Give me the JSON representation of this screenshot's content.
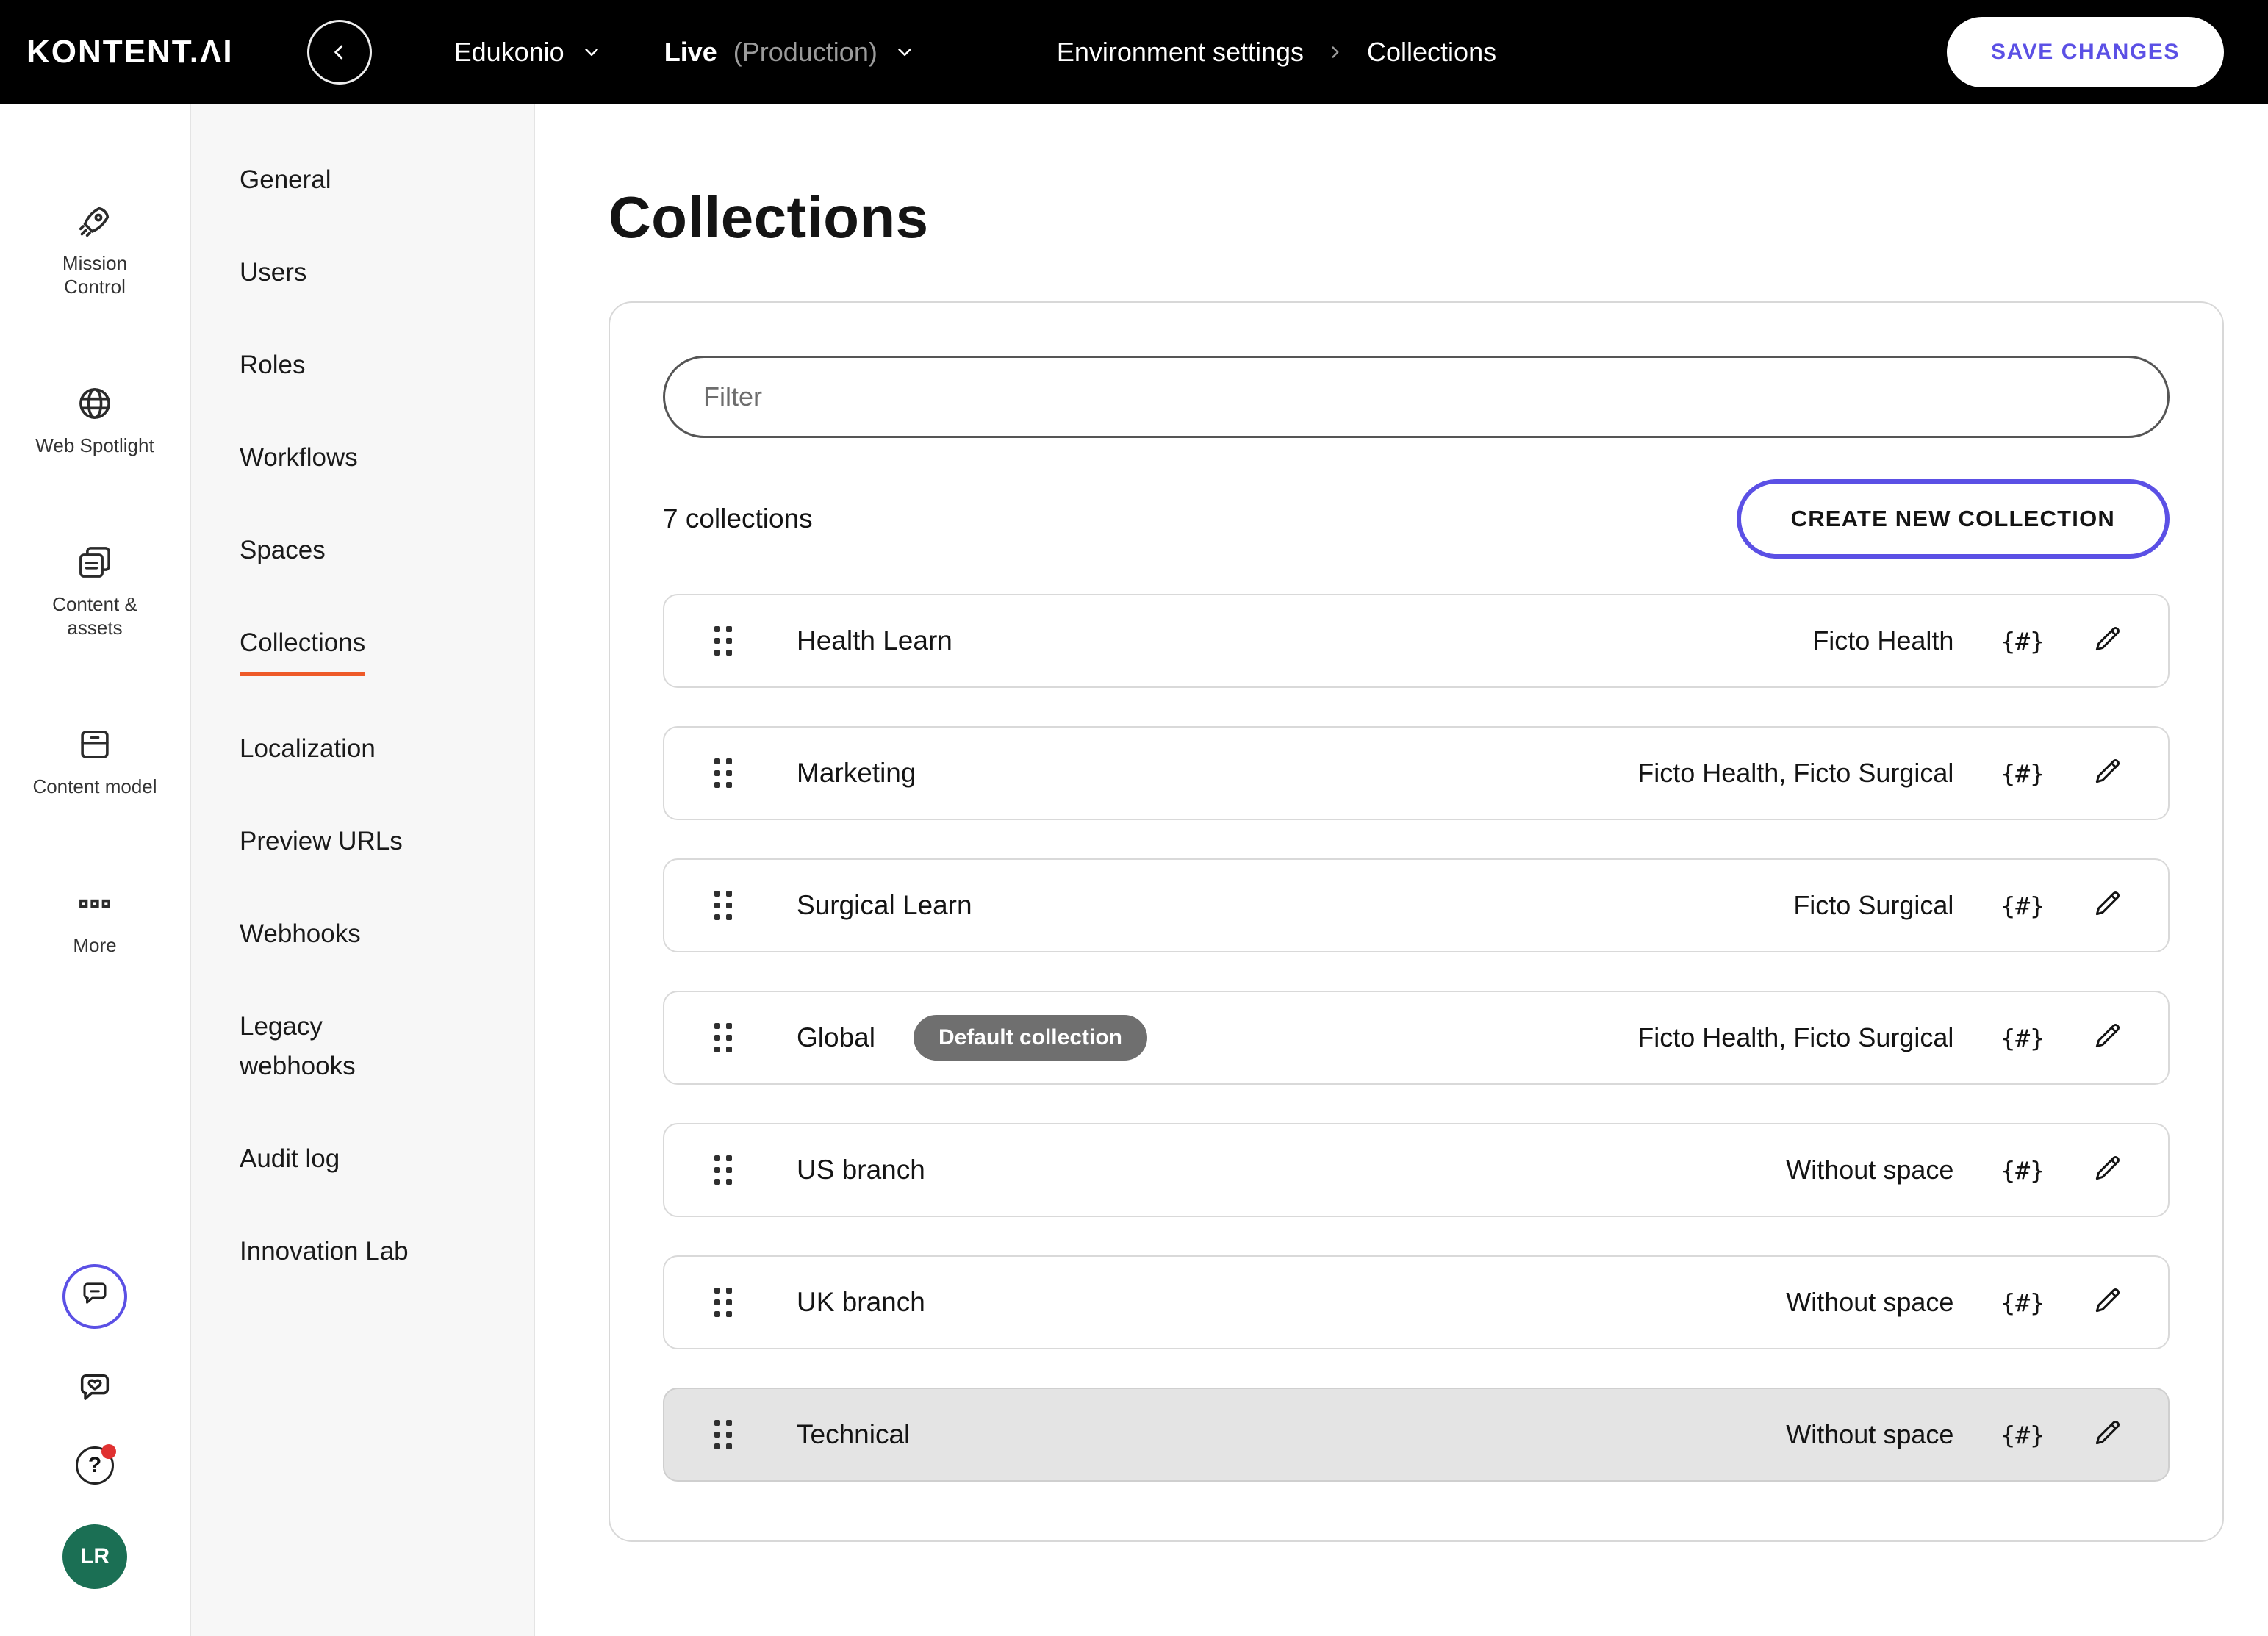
{
  "colors": {
    "topbar": "#000000",
    "accent": "#5b50e5",
    "underline": "#ee5a29",
    "avatar": "#1b6f54",
    "badge": "#6f6f6f"
  },
  "topbar": {
    "logo": "KONTENT.ΛI",
    "project": "Edukonio",
    "environment": "Live",
    "environment_suffix": "(Production)",
    "breadcrumb_parent": "Environment settings",
    "breadcrumb_current": "Collections",
    "save_button": "SAVE CHANGES"
  },
  "rail": {
    "items": [
      {
        "label": "Mission Control",
        "icon": "rocket-icon"
      },
      {
        "label": "Web Spotlight",
        "icon": "globe-icon"
      },
      {
        "label": "Content & assets",
        "icon": "content-assets-icon"
      },
      {
        "label": "Content model",
        "icon": "content-model-icon"
      },
      {
        "label": "More",
        "icon": "more-icon"
      }
    ],
    "avatar": "LR"
  },
  "settings_nav": {
    "items": [
      "General",
      "Users",
      "Roles",
      "Workflows",
      "Spaces",
      "Collections",
      "Localization",
      "Preview URLs",
      "Webhooks",
      "Legacy webhooks",
      "Audit log",
      "Innovation Lab"
    ],
    "active": "Collections"
  },
  "main": {
    "title": "Collections",
    "filter_placeholder": "Filter",
    "count_label": "7 collections",
    "create_button": "CREATE NEW COLLECTION",
    "default_badge": "Default collection",
    "codename_glyph": "{#}",
    "collections": [
      {
        "name": "Health Learn",
        "spaces": "Ficto Health"
      },
      {
        "name": "Marketing",
        "spaces": "Ficto Health, Ficto Surgical"
      },
      {
        "name": "Surgical Learn",
        "spaces": "Ficto Surgical"
      },
      {
        "name": "Global",
        "spaces": "Ficto Health, Ficto Surgical",
        "default": true
      },
      {
        "name": "US branch",
        "spaces": "Without space"
      },
      {
        "name": "UK branch",
        "spaces": "Without space"
      },
      {
        "name": "Technical",
        "spaces": "Without space",
        "selected": true
      }
    ]
  }
}
